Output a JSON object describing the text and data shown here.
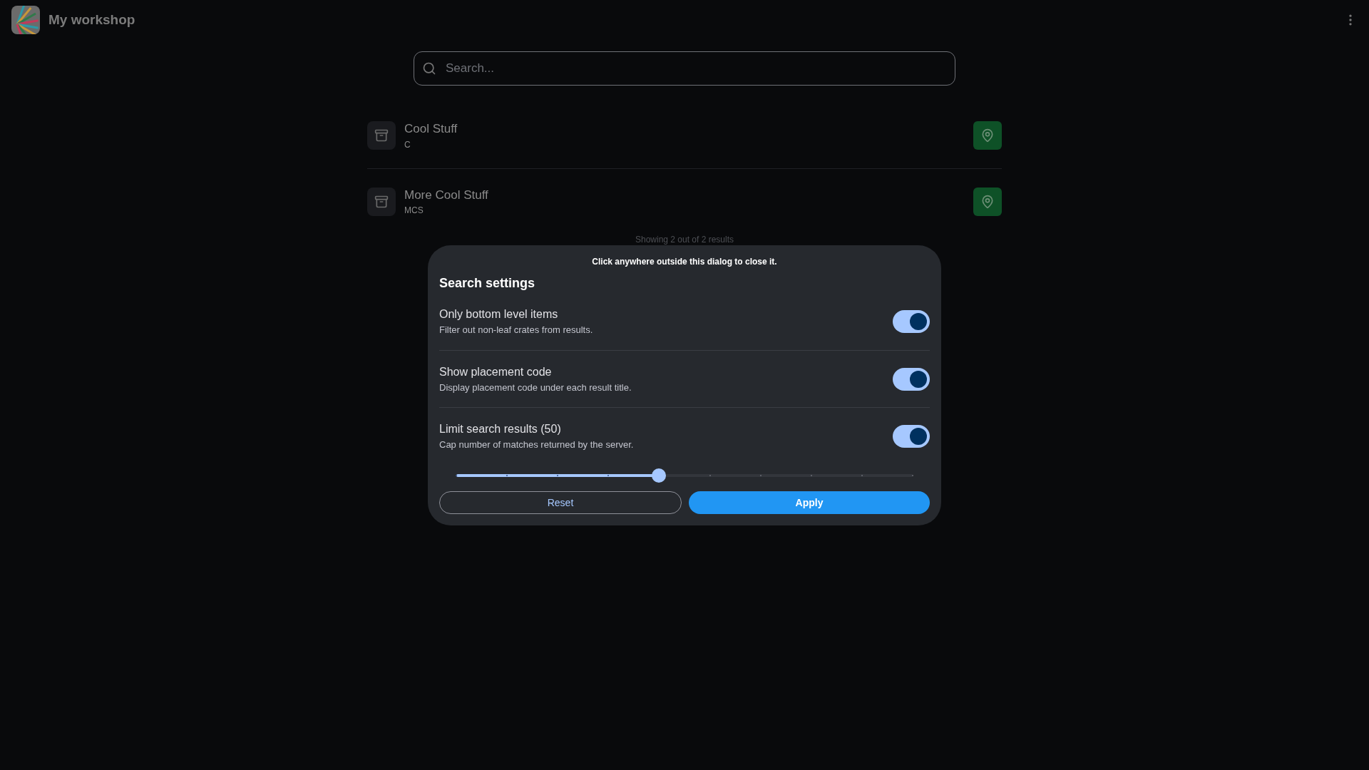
{
  "app": {
    "title": "My workshop"
  },
  "search": {
    "placeholder": "Search..."
  },
  "results": [
    {
      "title": "Cool Stuff",
      "code": "C"
    },
    {
      "title": "More Cool Stuff",
      "code": "MCS"
    }
  ],
  "results_summary": "Showing 2 out of 2 results",
  "dialog": {
    "hint": "Click anywhere outside this dialog to close it.",
    "title": "Search settings",
    "settings": [
      {
        "label": "Only bottom level items",
        "description": "Filter out non-leaf crates from results.",
        "on": true
      },
      {
        "label": "Show placement code",
        "description": "Display placement code under each result title.",
        "on": true
      },
      {
        "label": "Limit search results (50)",
        "description": "Cap number of matches returned by the server.",
        "on": true
      }
    ],
    "slider": {
      "level": 0.444
    },
    "buttons": [
      "Reset",
      "Apply"
    ]
  }
}
